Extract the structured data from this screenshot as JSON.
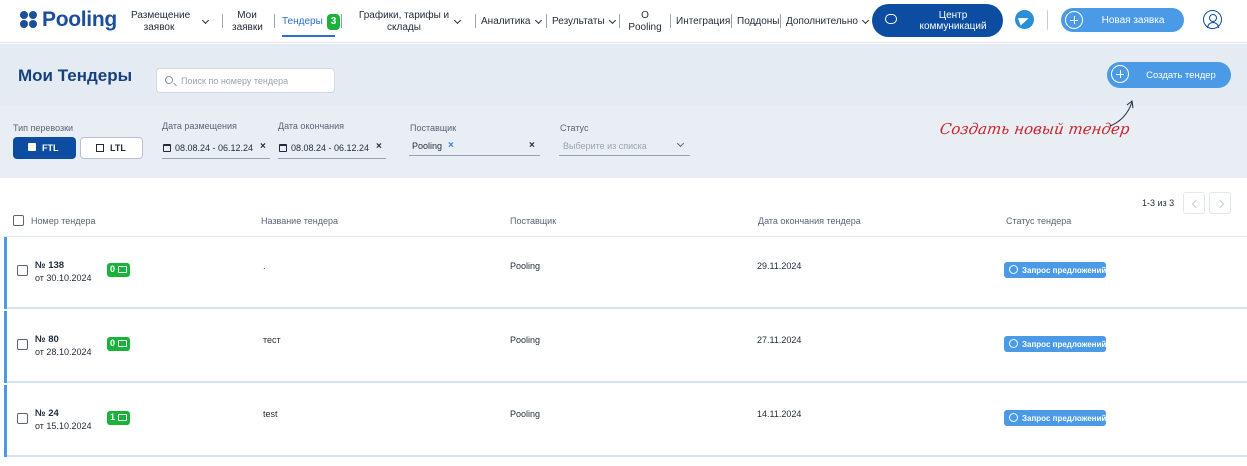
{
  "header": {
    "logo": "Pooling",
    "nav": {
      "placement": "Размещение заявок",
      "my_orders": "Мои заявки",
      "tenders": "Тендеры",
      "tenders_count": "3",
      "schedules": "Графики, тарифы и склады",
      "analytics": "Аналитика",
      "results": "Результаты",
      "about": "О Pooling",
      "integration": "Интеграция",
      "pallets": "Поддоны",
      "more": "Дополнительно"
    },
    "comm_center_label": "Центр коммуникаций",
    "new_order_label": "Новая заявка"
  },
  "page": {
    "title": "Мои Тендеры",
    "search_placeholder": "Поиск по номеру тендера",
    "create_label": "Создать тендер",
    "create_hint": "Создать новый тендер"
  },
  "filters": {
    "transport_label": "Тип перевозки",
    "ftl": "FTL",
    "ltl": "LTL",
    "placed_label": "Дата размещения",
    "placed_value": "08.08.24 - 06.12.24",
    "end_label": "Дата окончания",
    "end_value": "08.08.24 - 06.12.24",
    "provider_label": "Поставщик",
    "provider_value": "Pooling",
    "status_label": "Статус",
    "status_placeholder": "Выберите из списка"
  },
  "table": {
    "pager": "1-3 из 3",
    "columns": [
      "Номер тендера",
      "Название тендера",
      "Поставщик",
      "Дата окончания тендера",
      "Статус тендера"
    ],
    "rows": [
      {
        "number": "№ 138",
        "date": "от 30.10.2024",
        "count": "0",
        "name": ".",
        "provider": "Pooling",
        "end_date": "29.11.2024",
        "status": "Запрос предложений"
      },
      {
        "number": "№ 80",
        "date": "от 28.10.2024",
        "count": "0",
        "name": "тест",
        "provider": "Pooling",
        "end_date": "27.11.2024",
        "status": "Запрос предложений"
      },
      {
        "number": "№ 24",
        "date": "от 15.10.2024",
        "count": "1",
        "name": "test",
        "provider": "Pooling",
        "end_date": "14.11.2024",
        "status": "Запрос предложений"
      }
    ]
  },
  "colors": {
    "brand": "#1a4f9c",
    "accent": "#4a9ae8",
    "success": "#1ab23a",
    "hint": "#c6252b"
  }
}
